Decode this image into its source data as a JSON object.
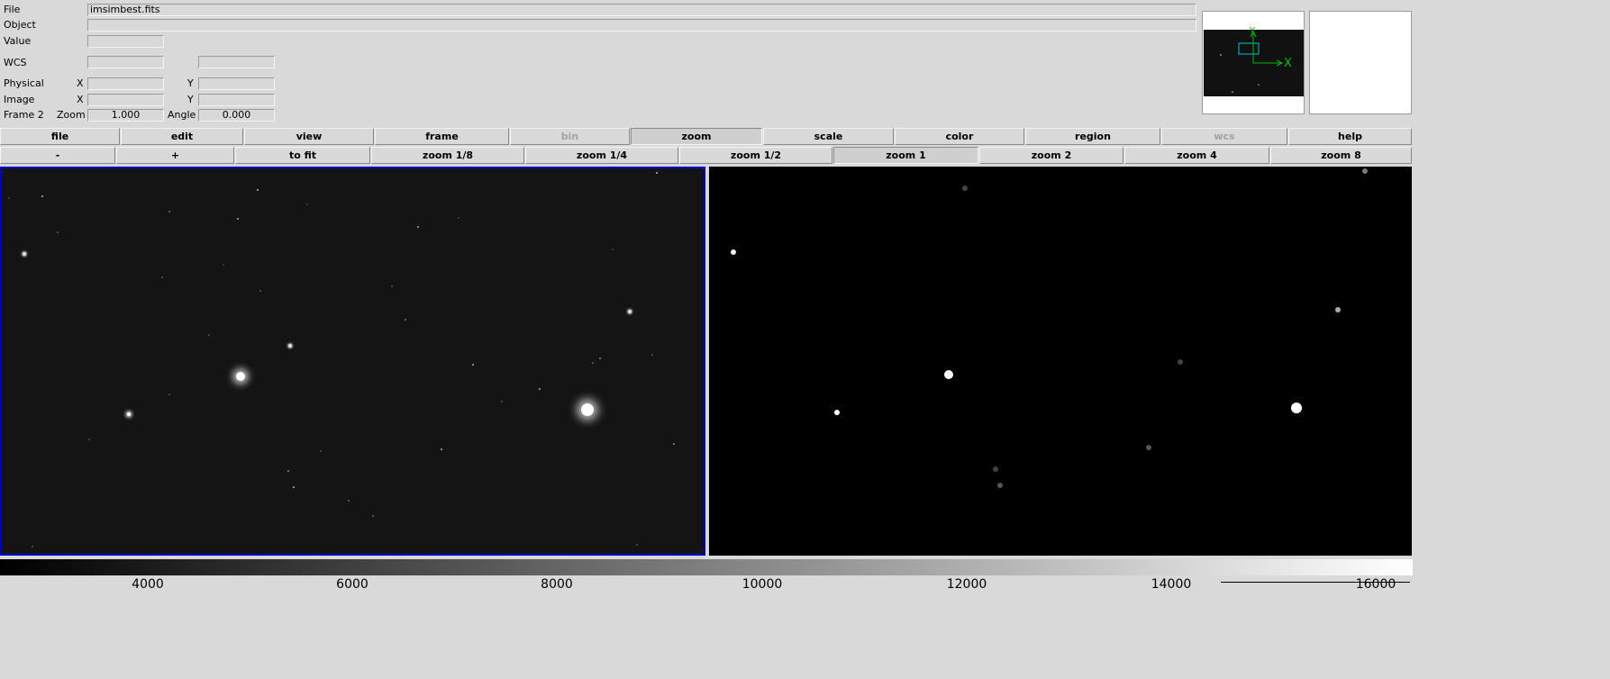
{
  "info_panel": {
    "file_label": "File",
    "file_value": "imsimbest.fits",
    "object_label": "Object",
    "object_value": "",
    "value_label": "Value",
    "value_value": "",
    "wcs_label": "WCS",
    "wcs_x_value": "",
    "wcs_y_value": "",
    "physical_label": "Physical",
    "physical_x_label": "X",
    "physical_y_label": "Y",
    "physical_x_value": "",
    "physical_y_value": "",
    "image_label": "Image",
    "image_x_label": "X",
    "image_y_label": "Y",
    "image_x_value": "",
    "image_y_value": "",
    "frame_label": "Frame 2",
    "zoom_label": "Zoom",
    "zoom_value": "1.000",
    "angle_label": "Angle",
    "angle_value": "0.000"
  },
  "panner": {
    "axis_x": "X",
    "axis_y": "Y"
  },
  "main_menu": [
    {
      "label": "file",
      "state": "normal"
    },
    {
      "label": "edit",
      "state": "normal"
    },
    {
      "label": "view",
      "state": "normal"
    },
    {
      "label": "frame",
      "state": "normal"
    },
    {
      "label": "bin",
      "state": "disabled"
    },
    {
      "label": "zoom",
      "state": "active"
    },
    {
      "label": "scale",
      "state": "normal"
    },
    {
      "label": "color",
      "state": "normal"
    },
    {
      "label": "region",
      "state": "normal"
    },
    {
      "label": "wcs",
      "state": "disabled"
    },
    {
      "label": "help",
      "state": "normal"
    }
  ],
  "zoom_menu": [
    {
      "label": "-",
      "state": "normal"
    },
    {
      "label": "+",
      "state": "normal"
    },
    {
      "label": "to fit",
      "state": "normal"
    },
    {
      "label": "zoom 1/8",
      "state": "normal"
    },
    {
      "label": "zoom 1/4",
      "state": "normal"
    },
    {
      "label": "zoom 1/2",
      "state": "normal"
    },
    {
      "label": "zoom 1",
      "state": "active"
    },
    {
      "label": "zoom 2",
      "state": "normal"
    },
    {
      "label": "zoom 4",
      "state": "normal"
    },
    {
      "label": "zoom 8",
      "state": "normal"
    }
  ],
  "frames": {
    "current_frame_highlight": "#0000cc"
  },
  "colorbar": {
    "ticks": [
      "4000",
      "6000",
      "8000",
      "10000",
      "12000",
      "14000",
      "16000"
    ]
  }
}
